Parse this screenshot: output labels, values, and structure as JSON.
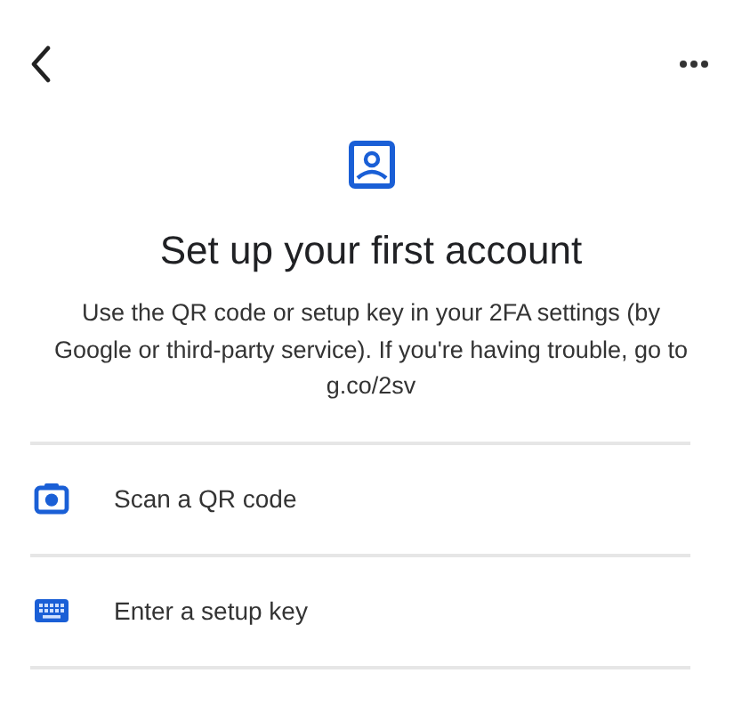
{
  "title": "Set up your first account",
  "description": "Use the QR code or setup key in your 2FA settings (by Google or third-party service). If you're having trouble, go to g.co/2sv",
  "options": [
    {
      "kind": "camera",
      "label": "Scan a QR code"
    },
    {
      "kind": "keyboard",
      "label": "Enter a setup key"
    }
  ]
}
